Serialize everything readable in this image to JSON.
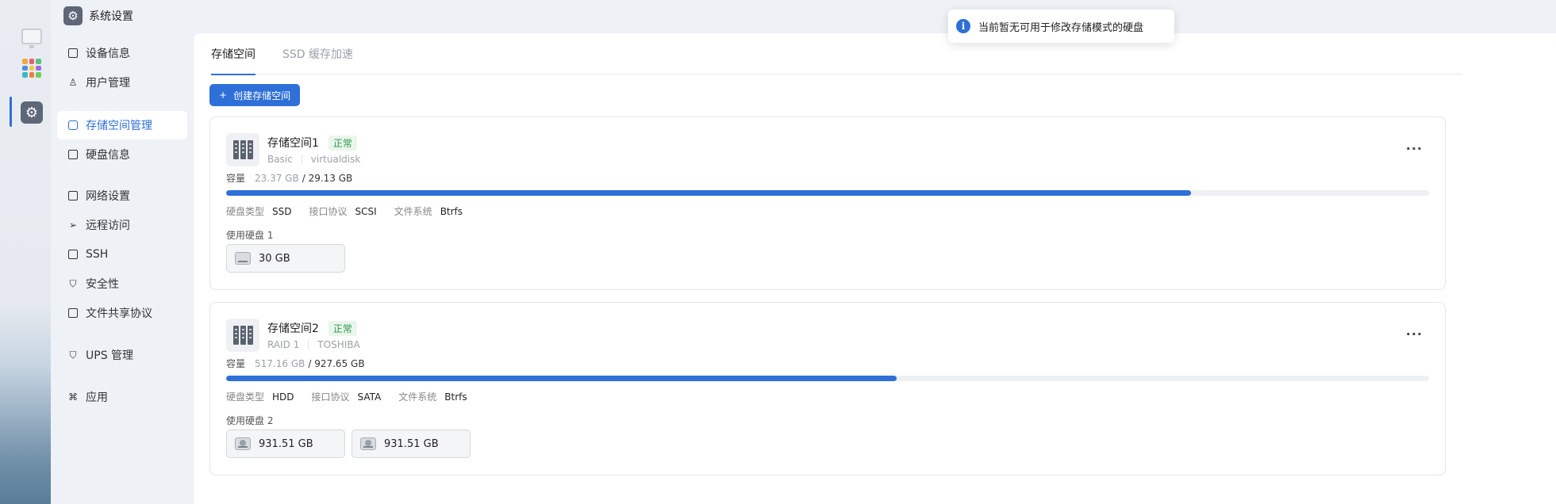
{
  "app": {
    "title": "系统设置"
  },
  "sidebar": {
    "items": [
      {
        "label": "设备信息",
        "icon": "device-icon"
      },
      {
        "label": "用户管理",
        "icon": "user-icon"
      },
      {
        "label": "存储空间管理",
        "icon": "storage-icon",
        "active": true
      },
      {
        "label": "硬盘信息",
        "icon": "disk-icon"
      },
      {
        "label": "网络设置",
        "icon": "network-icon"
      },
      {
        "label": "远程访问",
        "icon": "send-icon"
      },
      {
        "label": "SSH",
        "icon": "terminal-icon"
      },
      {
        "label": "安全性",
        "icon": "shield-icon"
      },
      {
        "label": "文件共享协议",
        "icon": "file-icon"
      },
      {
        "label": "UPS 管理",
        "icon": "ups-shield-icon"
      },
      {
        "label": "应用",
        "icon": "apps-icon"
      }
    ]
  },
  "tabs": [
    {
      "label": "存储空间",
      "active": true
    },
    {
      "label": "SSD 缓存加速",
      "active": false
    }
  ],
  "toolbar": {
    "create_label": "创建存储空间"
  },
  "toast": {
    "message": "当前暂无可用于修改存储模式的硬盘"
  },
  "pools": [
    {
      "name": "存储空间1",
      "status": "正常",
      "raid": "Basic",
      "vendor": "virtualdisk",
      "capacity_label": "容量",
      "used": "23.37 GB",
      "total": "/ 29.13 GB",
      "used_fraction": 0.8024,
      "disk_type_label": "硬盘类型",
      "disk_type": "SSD",
      "interface_label": "接口协议",
      "interface": "SCSI",
      "fs_label": "文件系统",
      "fs": "Btrfs",
      "disks_label": "使用硬盘 1",
      "disks": [
        "30 GB"
      ]
    },
    {
      "name": "存储空间2",
      "status": "正常",
      "raid": "RAID 1",
      "vendor": "TOSHIBA",
      "capacity_label": "容量",
      "used": "517.16 GB",
      "total": "/ 927.65 GB",
      "used_fraction": 0.5575,
      "disk_type_label": "硬盘类型",
      "disk_type": "HDD",
      "interface_label": "接口协议",
      "interface": "SATA",
      "fs_label": "文件系统",
      "fs": "Btrfs",
      "disks_label": "使用硬盘 2",
      "disks": [
        "931.51 GB",
        "931.51 GB"
      ]
    }
  ],
  "colors": {
    "accent": "#2e6fd8",
    "status_ok": "#2f9a4b"
  }
}
